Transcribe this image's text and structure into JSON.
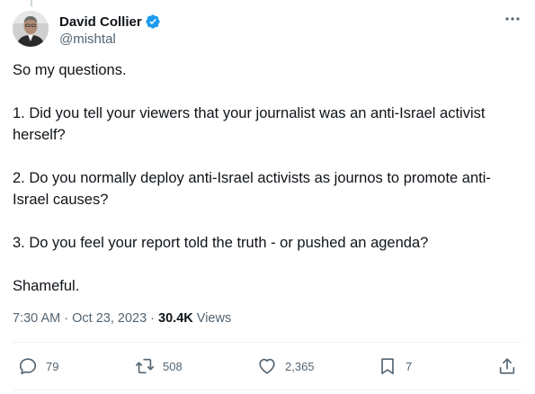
{
  "author": {
    "display_name": "David Collier",
    "handle": "@mishtal",
    "verified": true
  },
  "tweet": {
    "paragraphs": [
      "So my questions.",
      "1. Did you tell your viewers that your journalist was an anti-Israel activist herself?",
      "2. Do you normally deploy anti-Israel activists as journos to promote anti-Israel causes?",
      "3. Do you feel your report told the truth - or pushed an agenda?",
      "Shameful."
    ]
  },
  "meta": {
    "time": "7:30 AM",
    "separator": "·",
    "date": "Oct 23, 2023",
    "views_count": "30.4K",
    "views_label": "Views"
  },
  "actions": {
    "replies": "79",
    "reposts": "508",
    "likes": "2,365",
    "bookmarks": "7"
  },
  "colors": {
    "text": "#0f1419",
    "secondary": "#536471",
    "verified": "#1d9bf0",
    "divider": "#eff3f4"
  },
  "icons": {
    "more": "more-icon",
    "verified": "verified-badge-icon",
    "reply": "reply-icon",
    "repost": "repost-icon",
    "like": "like-icon",
    "bookmark": "bookmark-icon",
    "share": "share-icon"
  }
}
